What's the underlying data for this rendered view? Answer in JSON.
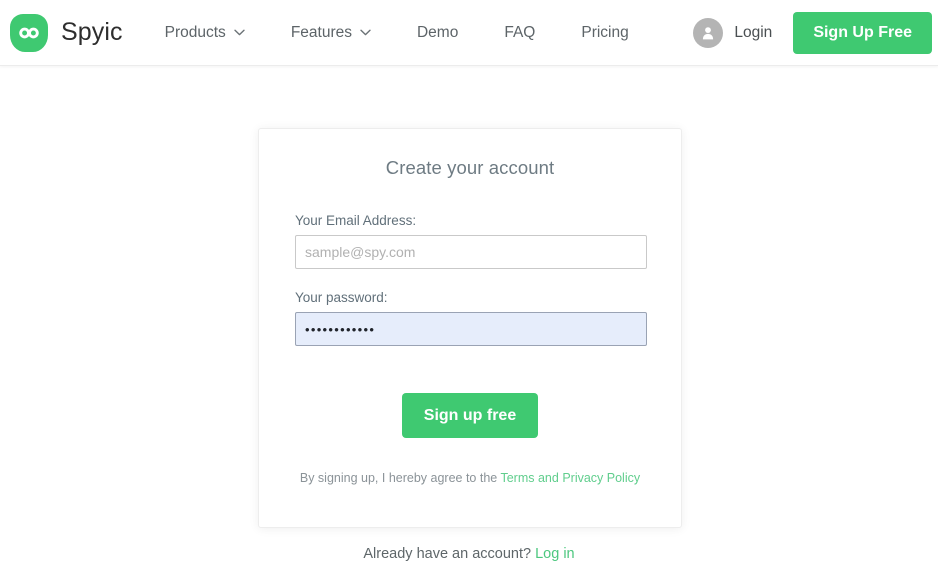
{
  "brand": {
    "name": "Spyic",
    "logo_icon": "infinity-icon",
    "color": "#3fc971"
  },
  "nav": {
    "items": [
      {
        "label": "Products",
        "has_dropdown": true,
        "icon": "chevron-down-icon"
      },
      {
        "label": "Features",
        "has_dropdown": true,
        "icon": "chevron-down-icon"
      },
      {
        "label": "Demo",
        "has_dropdown": false,
        "icon": ""
      },
      {
        "label": "FAQ",
        "has_dropdown": false,
        "icon": ""
      },
      {
        "label": "Pricing",
        "has_dropdown": false,
        "icon": ""
      }
    ]
  },
  "header_right": {
    "avatar_icon": "user-avatar-icon",
    "login_label": "Login",
    "signup_label": "Sign Up Free"
  },
  "card": {
    "title": "Create your account",
    "email": {
      "label": "Your Email Address:",
      "placeholder": "sample@spy.com",
      "value": ""
    },
    "password": {
      "label": "Your password:",
      "placeholder": "",
      "value": "............",
      "autofilled": true
    },
    "submit_label": "Sign up free",
    "terms_prefix": "By signing up, I hereby agree to the ",
    "terms_link": "Terms and Privacy Policy"
  },
  "footer": {
    "prompt": "Already have an account? ",
    "login_link": "Log in"
  }
}
